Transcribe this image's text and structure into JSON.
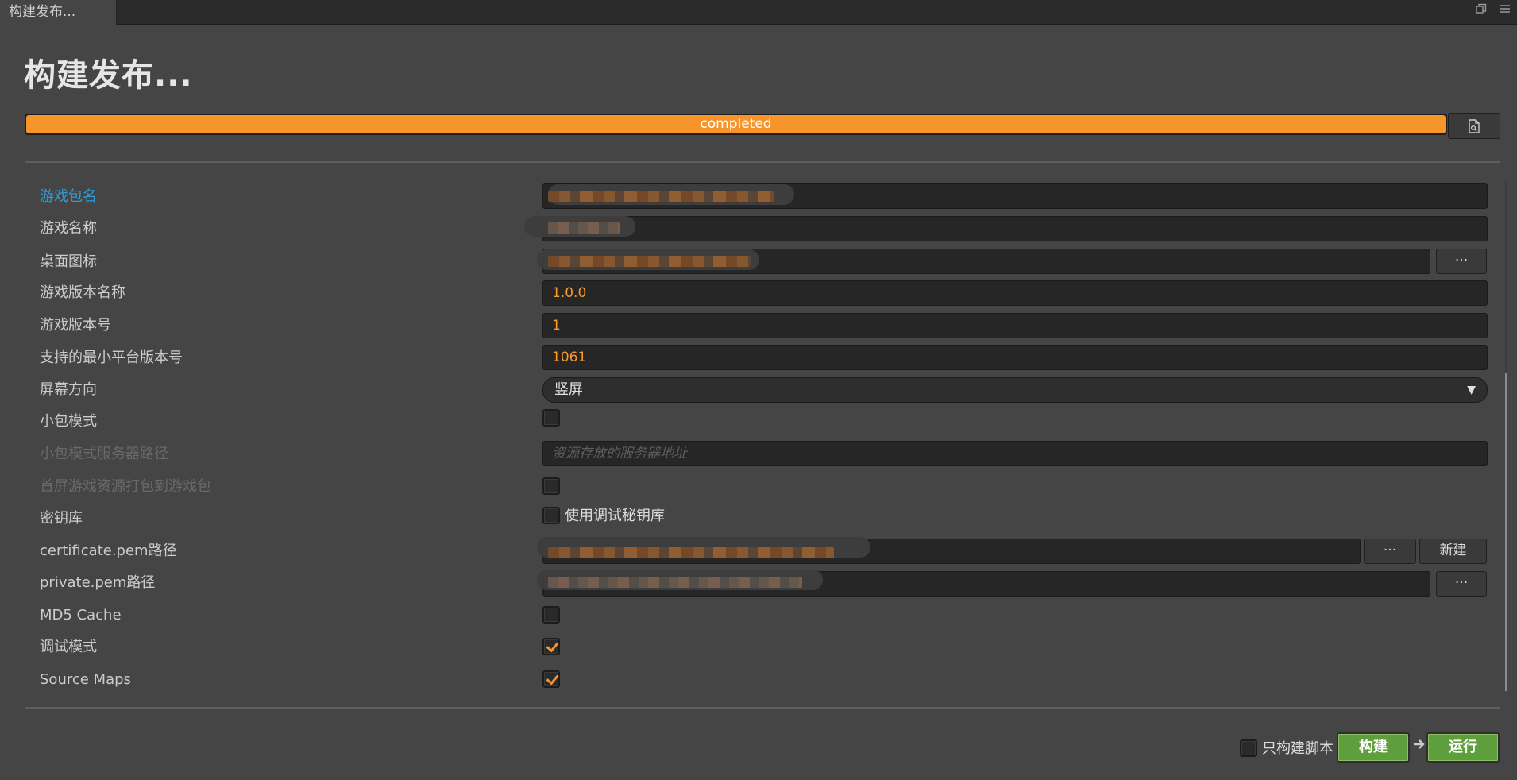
{
  "window": {
    "tab_title": "构建发布...",
    "restore_icon": "restore-window-icon",
    "menu_icon": "menu-icon"
  },
  "page": {
    "title": "构建发布..."
  },
  "progress": {
    "status": "completed",
    "percent": 100,
    "open_log_icon": "log-file-icon"
  },
  "form": {
    "game_package_name": {
      "label": "游戏包名"
    },
    "game_name": {
      "label": "游戏名称"
    },
    "desktop_icon": {
      "label": "桌面图标",
      "browse_label": "···"
    },
    "version_name": {
      "label": "游戏版本名称",
      "value": "1.0.0"
    },
    "version_code": {
      "label": "游戏版本号",
      "value": "1"
    },
    "min_platform_version": {
      "label": "支持的最小平台版本号",
      "value": "1061"
    },
    "orientation": {
      "label": "屏幕方向",
      "value": "竖屏"
    },
    "small_package_mode": {
      "label": "小包模式",
      "checked": false
    },
    "small_package_server": {
      "label": "小包模式服务器路径",
      "placeholder": "资源存放的服务器地址"
    },
    "first_screen_pack": {
      "label": "首屏游戏资源打包到游戏包",
      "checked": false
    },
    "keystore": {
      "label": "密钥库",
      "checkbox_label": "使用调试秘钥库",
      "checked": false
    },
    "certificate_path": {
      "label": "certificate.pem路径",
      "browse_label": "···",
      "new_label": "新建"
    },
    "private_path": {
      "label": "private.pem路径",
      "browse_label": "···"
    },
    "md5_cache": {
      "label": "MD5 Cache",
      "checked": false
    },
    "debug_mode": {
      "label": "调试模式",
      "checked": true
    },
    "source_maps": {
      "label": "Source Maps",
      "checked": true
    }
  },
  "footer": {
    "build_script_only_label": "只构建脚本",
    "build_script_only_checked": false,
    "build_button": "构建",
    "run_button": "运行",
    "arrow_icon": "arrow-right-icon"
  }
}
